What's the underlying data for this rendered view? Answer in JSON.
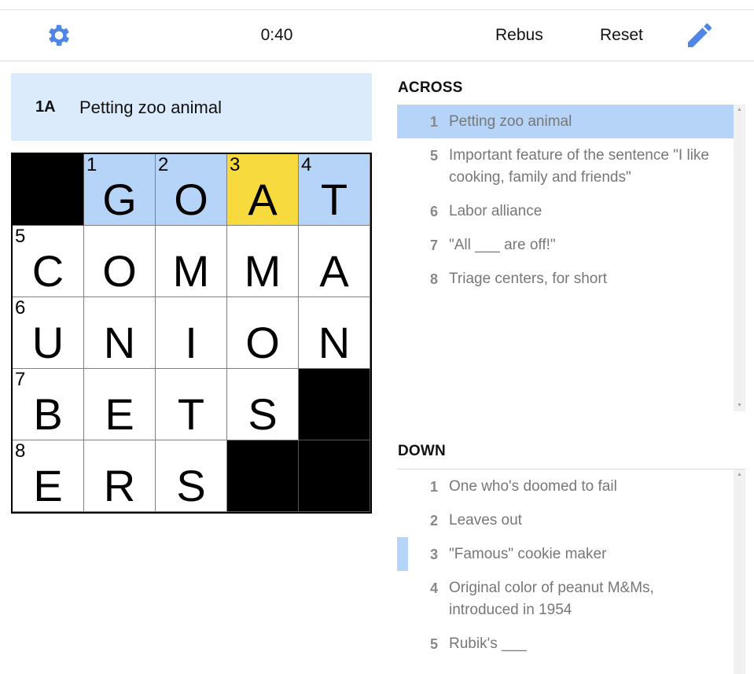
{
  "toolbar": {
    "timer": "0:40",
    "rebus_label": "Rebus",
    "reset_label": "Reset",
    "settings_icon": "gear-icon",
    "pencil_icon": "pencil-icon",
    "accent": "#4f85e5"
  },
  "current_clue": {
    "number": "1A",
    "text": "Petting zoo animal"
  },
  "grid": {
    "rows": [
      [
        {
          "black": true
        },
        {
          "num": "1",
          "letter": "G",
          "state": "word"
        },
        {
          "num": "2",
          "letter": "O",
          "state": "word"
        },
        {
          "num": "3",
          "letter": "A",
          "state": "selected"
        },
        {
          "num": "4",
          "letter": "T",
          "state": "word"
        }
      ],
      [
        {
          "num": "5",
          "letter": "C"
        },
        {
          "letter": "O"
        },
        {
          "letter": "M"
        },
        {
          "letter": "M"
        },
        {
          "letter": "A"
        }
      ],
      [
        {
          "num": "6",
          "letter": "U"
        },
        {
          "letter": "N"
        },
        {
          "letter": "I"
        },
        {
          "letter": "O"
        },
        {
          "letter": "N"
        }
      ],
      [
        {
          "num": "7",
          "letter": "B"
        },
        {
          "letter": "E"
        },
        {
          "letter": "T"
        },
        {
          "letter": "S"
        },
        {
          "black": true
        }
      ],
      [
        {
          "num": "8",
          "letter": "E"
        },
        {
          "letter": "R"
        },
        {
          "letter": "S"
        },
        {
          "black": true
        },
        {
          "black": true
        }
      ]
    ],
    "colors": {
      "word": "#b6d4f8",
      "selected": "#f7da3d",
      "black": "#000000"
    }
  },
  "across": {
    "title": "ACROSS",
    "clues": [
      {
        "num": "1",
        "text": "Petting zoo animal",
        "active": true
      },
      {
        "num": "5",
        "text": "Important feature of the sentence \"I like cooking, family and friends\""
      },
      {
        "num": "6",
        "text": "Labor alliance"
      },
      {
        "num": "7",
        "text": "\"All ___ are off!\""
      },
      {
        "num": "8",
        "text": "Triage centers, for short"
      }
    ]
  },
  "down": {
    "title": "DOWN",
    "clues": [
      {
        "num": "1",
        "text": "One who's doomed to fail"
      },
      {
        "num": "2",
        "text": "Leaves out"
      },
      {
        "num": "3",
        "text": "\"Famous\" cookie maker",
        "crossing": true
      },
      {
        "num": "4",
        "text": "Original color of peanut M&Ms, introduced in 1954"
      },
      {
        "num": "5",
        "text": "Rubik's ___"
      }
    ]
  }
}
